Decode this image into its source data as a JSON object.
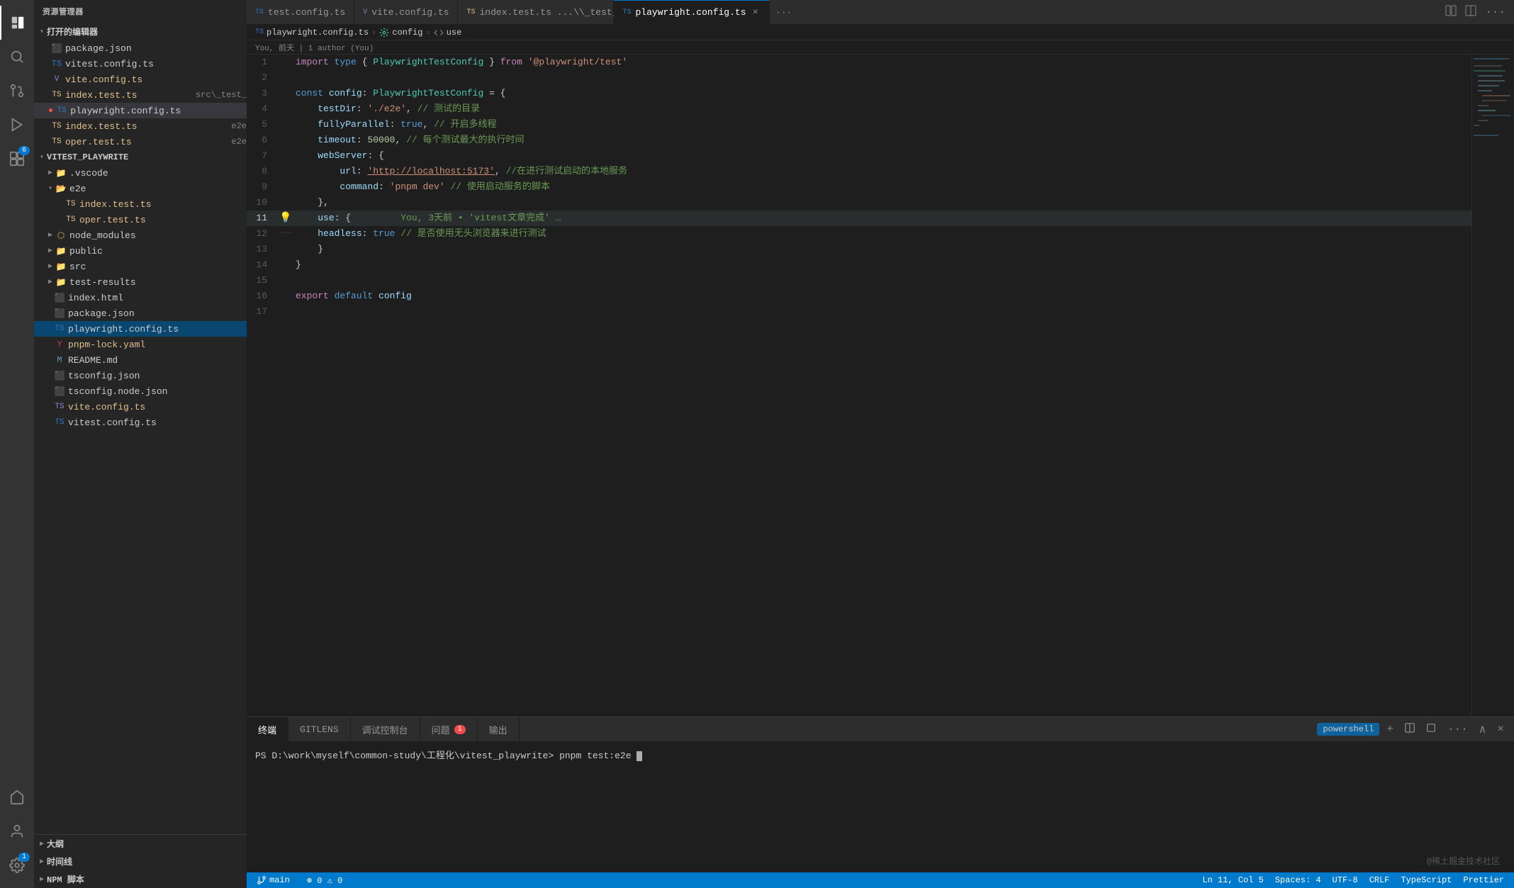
{
  "activityBar": {
    "items": [
      {
        "name": "explorer-icon",
        "icon": "⬜",
        "label": "资源管理器",
        "active": true
      },
      {
        "name": "search-icon",
        "icon": "🔍",
        "label": "搜索",
        "active": false
      },
      {
        "name": "source-control-icon",
        "icon": "⑂",
        "label": "源代码管理",
        "active": false
      },
      {
        "name": "run-icon",
        "icon": "▶",
        "label": "运行和调试",
        "active": false
      },
      {
        "name": "extensions-icon",
        "icon": "⧉",
        "label": "扩展",
        "active": false,
        "badge": "6"
      }
    ],
    "bottomItems": [
      {
        "name": "remote-icon",
        "icon": "⌂",
        "label": "远程资源管理器",
        "active": false
      },
      {
        "name": "account-icon",
        "icon": "👤",
        "label": "账户",
        "active": false
      },
      {
        "name": "settings-icon",
        "icon": "⚙",
        "label": "设置",
        "active": false,
        "badge": "1"
      }
    ]
  },
  "sidebar": {
    "title": "资源管理器",
    "openEditors": {
      "label": "打开的编辑器",
      "items": [
        {
          "name": "package.json",
          "icon": "json",
          "indent": 1
        },
        {
          "name": "vitest.config.ts",
          "icon": "ts",
          "indent": 1
        },
        {
          "name": "vite.config.ts",
          "icon": "vite",
          "indent": 1,
          "gitModified": true
        },
        {
          "name": "index.test.ts",
          "icon": "ts",
          "indent": 1,
          "sublabel": "src\\_test_",
          "gitModified": true
        },
        {
          "name": "playwright.config.ts",
          "icon": "ts",
          "indent": 1,
          "active": true,
          "modified": true
        },
        {
          "name": "index.test.ts (e2e)",
          "icon": "ts",
          "sublabel": "e2e",
          "indent": 1,
          "gitModified": true
        },
        {
          "name": "oper.test.ts (e2e)",
          "icon": "ts",
          "sublabel": "e2e",
          "indent": 1,
          "gitModified": true
        }
      ]
    },
    "projectTree": {
      "rootLabel": "VITEST_PLAYWRITE",
      "items": [
        {
          "name": ".vscode",
          "type": "folder",
          "indent": 1,
          "collapsed": true
        },
        {
          "name": "e2e",
          "type": "folder-open",
          "indent": 1,
          "collapsed": false
        },
        {
          "name": "index.test.ts",
          "type": "ts",
          "indent": 3
        },
        {
          "name": "oper.test.ts",
          "type": "ts",
          "indent": 3
        },
        {
          "name": "node_modules",
          "type": "folder-node",
          "indent": 1,
          "collapsed": true
        },
        {
          "name": "public",
          "type": "folder",
          "indent": 1,
          "collapsed": true
        },
        {
          "name": "src",
          "type": "folder",
          "indent": 1,
          "collapsed": true
        },
        {
          "name": "test-results",
          "type": "folder",
          "indent": 1,
          "collapsed": true
        },
        {
          "name": "index.html",
          "type": "html",
          "indent": 1
        },
        {
          "name": "package.json",
          "type": "json",
          "indent": 1
        },
        {
          "name": "playwright.config.ts",
          "type": "ts",
          "indent": 1,
          "active": true
        },
        {
          "name": "pnpm-lock.yaml",
          "type": "yaml",
          "indent": 1,
          "gitModified": true
        },
        {
          "name": "README.md",
          "type": "md",
          "indent": 1
        },
        {
          "name": "tsconfig.json",
          "type": "json2",
          "indent": 1
        },
        {
          "name": "tsconfig.node.json",
          "type": "json2",
          "indent": 1
        },
        {
          "name": "vite.config.ts",
          "type": "ts",
          "indent": 1,
          "gitModified": true
        },
        {
          "name": "vitest.config.ts",
          "type": "ts",
          "indent": 1
        }
      ]
    },
    "bottomSections": [
      {
        "label": "大纲"
      },
      {
        "label": "时间线"
      },
      {
        "label": "NPM 脚本"
      }
    ]
  },
  "tabs": [
    {
      "label": "test.config.ts",
      "icon": "ts",
      "active": false,
      "modified": false
    },
    {
      "label": "vite.config.ts",
      "icon": "vite",
      "active": false,
      "modified": false
    },
    {
      "label": "index.test.ts ...\\_test_",
      "icon": "ts-git",
      "active": false,
      "modified": false
    },
    {
      "label": "playwright.config.ts",
      "icon": "ts",
      "active": true,
      "modified": false,
      "closeable": true
    }
  ],
  "breadcrumb": {
    "parts": [
      "playwright.config.ts",
      "config",
      "use"
    ]
  },
  "gitBlame": {
    "text": "You, 前天 | 1 author (You)"
  },
  "editor": {
    "filename": "playwright.config.ts",
    "lines": [
      {
        "num": 1,
        "tokens": [
          {
            "text": "import",
            "cls": "kw2"
          },
          {
            "text": " "
          },
          {
            "text": "type",
            "cls": "kw"
          },
          {
            "text": " { "
          },
          {
            "text": "PlaywrightTestConfig",
            "cls": "type"
          },
          {
            "text": " } "
          },
          {
            "text": "from",
            "cls": "kw2"
          },
          {
            "text": " "
          },
          {
            "text": "'@playwright/test'",
            "cls": "str"
          }
        ]
      },
      {
        "num": 2,
        "tokens": []
      },
      {
        "num": 3,
        "tokens": [
          {
            "text": "const",
            "cls": "kw"
          },
          {
            "text": " "
          },
          {
            "text": "config",
            "cls": "var"
          },
          {
            "text": ": "
          },
          {
            "text": "PlaywrightTestConfig",
            "cls": "type"
          },
          {
            "text": " = {"
          }
        ]
      },
      {
        "num": 4,
        "tokens": [
          {
            "text": "    "
          },
          {
            "text": "testDir",
            "cls": "prop"
          },
          {
            "text": ": "
          },
          {
            "text": "'./e2e'",
            "cls": "str"
          },
          {
            "text": ", "
          },
          {
            "text": "// 测试的目录",
            "cls": "comment"
          }
        ]
      },
      {
        "num": 5,
        "tokens": [
          {
            "text": "    "
          },
          {
            "text": "fullyParallel",
            "cls": "prop"
          },
          {
            "text": ": "
          },
          {
            "text": "true",
            "cls": "bool"
          },
          {
            "text": ", "
          },
          {
            "text": "// 开启多线程",
            "cls": "comment"
          }
        ]
      },
      {
        "num": 6,
        "tokens": [
          {
            "text": "    "
          },
          {
            "text": "timeout",
            "cls": "prop"
          },
          {
            "text": ": "
          },
          {
            "text": "50000",
            "cls": "num"
          },
          {
            "text": ", "
          },
          {
            "text": "// 每个测试最大的执行时间",
            "cls": "comment"
          }
        ]
      },
      {
        "num": 7,
        "tokens": [
          {
            "text": "    "
          },
          {
            "text": "webServer",
            "cls": "prop"
          },
          {
            "text": ": {"
          }
        ]
      },
      {
        "num": 8,
        "tokens": [
          {
            "text": "        "
          },
          {
            "text": "url",
            "cls": "prop"
          },
          {
            "text": ": "
          },
          {
            "text": "'http://localhost:5173'",
            "cls": "str-link"
          },
          {
            "text": ", "
          },
          {
            "text": "//在进行测试启动的本地服务",
            "cls": "comment"
          }
        ]
      },
      {
        "num": 9,
        "tokens": [
          {
            "text": "        "
          },
          {
            "text": "command",
            "cls": "prop"
          },
          {
            "text": ": "
          },
          {
            "text": "'pnpm dev'",
            "cls": "str"
          },
          {
            "text": " "
          },
          {
            "text": "// 使用启动服务的脚本",
            "cls": "comment"
          }
        ]
      },
      {
        "num": 10,
        "tokens": [
          {
            "text": "    "
          },
          {
            "text": "},",
            "cls": "punct"
          }
        ]
      },
      {
        "num": 11,
        "tokens": [
          {
            "text": "    "
          },
          {
            "text": "use",
            "cls": "prop"
          },
          {
            "text": ": {"
          },
          {
            "text": "         You, 3天前 • 'vitest文章完成' …",
            "cls": "comment"
          }
        ],
        "hasGutter": true,
        "gutterIcon": "💡"
      },
      {
        "num": 12,
        "tokens": [
          {
            "text": "···"
          },
          {
            "text": "    "
          },
          {
            "text": "headless",
            "cls": "prop"
          },
          {
            "text": ": "
          },
          {
            "text": "true",
            "cls": "bool"
          },
          {
            "text": " "
          },
          {
            "text": "// 是否使用无头浏览器来进行测试",
            "cls": "comment"
          }
        ]
      },
      {
        "num": 13,
        "tokens": [
          {
            "text": "    "
          },
          {
            "text": "}",
            "cls": "punct"
          }
        ]
      },
      {
        "num": 14,
        "tokens": [
          {
            "text": "}"
          }
        ]
      },
      {
        "num": 15,
        "tokens": []
      },
      {
        "num": 16,
        "tokens": [
          {
            "text": "export",
            "cls": "kw2"
          },
          {
            "text": " "
          },
          {
            "text": "default",
            "cls": "kw"
          },
          {
            "text": " "
          },
          {
            "text": "config",
            "cls": "var"
          }
        ]
      },
      {
        "num": 17,
        "tokens": []
      }
    ]
  },
  "terminal": {
    "tabs": [
      {
        "label": "终端",
        "active": true
      },
      {
        "label": "GITLENS",
        "active": false
      },
      {
        "label": "调试控制台",
        "active": false
      },
      {
        "label": "问题",
        "active": false,
        "badge": "1"
      },
      {
        "label": "输出",
        "active": false
      }
    ],
    "shellLabel": "powershell",
    "prompt": "PS D:\\work\\myself\\common-study\\工程化\\vitest_playwrite>",
    "command": " pnpm test:e2e"
  },
  "statusBar": {
    "left": [
      {
        "text": "⎇ main",
        "name": "git-branch"
      },
      {
        "text": "⊗ 0  ⚠ 0",
        "name": "errors-warnings"
      }
    ],
    "right": [
      {
        "text": "Ln 11, Col 5",
        "name": "cursor-position"
      },
      {
        "text": "Spaces: 4",
        "name": "indentation"
      },
      {
        "text": "UTF-8",
        "name": "encoding"
      },
      {
        "text": "CRLF",
        "name": "line-ending"
      },
      {
        "text": "TypeScript",
        "name": "language-mode"
      },
      {
        "text": "Prettier",
        "name": "formatter"
      }
    ]
  },
  "watermark": "@稀土掘金技术社区"
}
